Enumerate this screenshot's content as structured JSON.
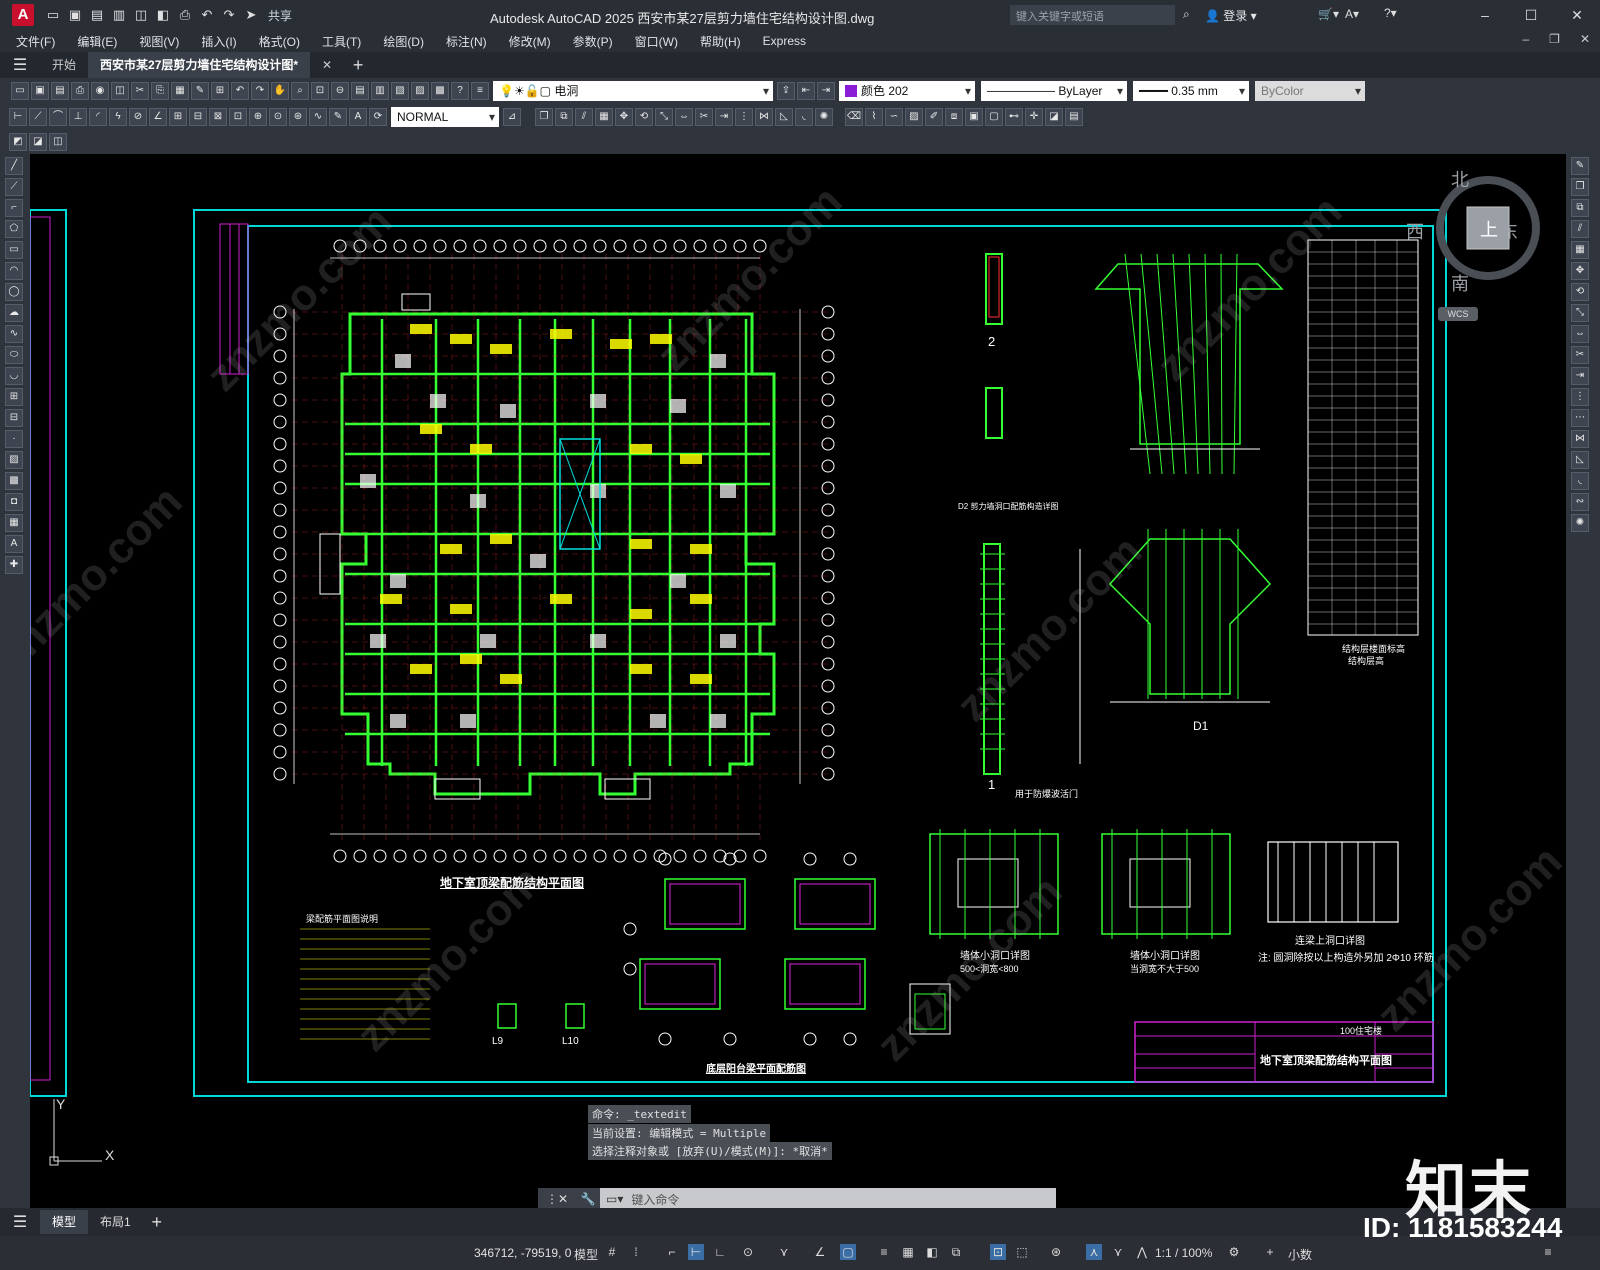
{
  "window": {
    "app_logo": "A",
    "title": "Autodesk AutoCAD 2025    西安市某27层剪力墙住宅结构设计图.dwg",
    "share_label": "共享",
    "search_placeholder": "键入关键字或短语",
    "login_label": "登录"
  },
  "menu": [
    "文件(F)",
    "编辑(E)",
    "视图(V)",
    "插入(I)",
    "格式(O)",
    "工具(T)",
    "绘图(D)",
    "标注(N)",
    "修改(M)",
    "参数(P)",
    "窗口(W)",
    "帮助(H)",
    "Express"
  ],
  "tabs": {
    "start": "开始",
    "active": "西安市某27层剪力墙住宅结构设计图*"
  },
  "properties": {
    "layer_name": "电洞",
    "color_label": "颜色 202",
    "color_hex": "#8a1bd6",
    "linetype": "ByLayer",
    "lineweight": "0.35 mm",
    "plotstyle": "ByColor",
    "dimstyle": "NORMAL"
  },
  "viewcube": {
    "north": "北",
    "south": "南",
    "east": "东",
    "west": "西",
    "face": "上",
    "wcs": "WCS"
  },
  "drawing": {
    "main_title": "地下室顶梁配筋结构平面图",
    "balcony_title": "底层阳台梁平面配筋图",
    "note_title": "梁配筋平面图说明",
    "detail_title_1": "墙体小洞口详图",
    "detail_title_2": "墙体小洞口详图",
    "detail_title_3": "连梁上洞口详图",
    "detail_sub_1": "500<洞宽<800",
    "detail_sub_2": "当洞宽不大于500",
    "detail_note": "注: 圆洞除按以上构造外另加 2Φ10 环筋",
    "table_title": "结构层楼面标高",
    "table_sub": "结构层高",
    "d1_label": "D1",
    "section_1": "1",
    "section_2": "2",
    "d2_note": "D2 剪力墙洞口配筋构造详图",
    "sec1_note": "用于防爆波活门",
    "titleblock_title": "地下室顶梁配筋结构平面图",
    "titleblock_project": "100住宅楼",
    "l9": "L9",
    "l10": "L10"
  },
  "command": {
    "history": [
      "命令: _textedit",
      "当前设置: 编辑模式 = Multiple",
      "选择注释对象或 [放弃(U)/模式(M)]: *取消*"
    ],
    "placeholder": "键入命令"
  },
  "layouts": {
    "model": "模型",
    "layout1": "布局1"
  },
  "status": {
    "coords": "346712, -79519, 0",
    "mode": "模型",
    "scale": "1:1 / 100%",
    "units": "小数"
  },
  "watermark": {
    "brand": "知末",
    "id": "ID: 1181583244",
    "site": "znzmo.com"
  }
}
